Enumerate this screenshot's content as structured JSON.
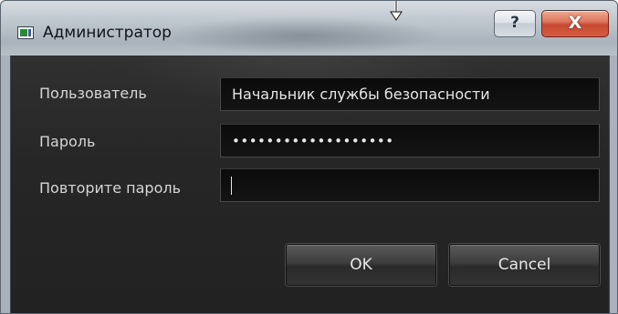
{
  "window": {
    "title": "Администратор"
  },
  "titlebar": {
    "help_label": "?",
    "close_label": "X"
  },
  "form": {
    "user_label": "Пользователь",
    "user_value": "Начальник службы безопасности",
    "password_label": "Пароль",
    "password_value": "•••••••••••••••••••",
    "repeat_label": "Повторите пароль",
    "repeat_value": ""
  },
  "buttons": {
    "ok_label": "OK",
    "cancel_label": "Cancel"
  },
  "icons": {
    "app": "app-window-icon",
    "help": "help-icon",
    "close": "close-icon",
    "cursor": "resize-down-arrow-icon"
  },
  "colors": {
    "client_bg": "#262626",
    "field_bg": "#0f0f0f",
    "text": "#d6d6d6",
    "close_accent": "#c64a31"
  }
}
